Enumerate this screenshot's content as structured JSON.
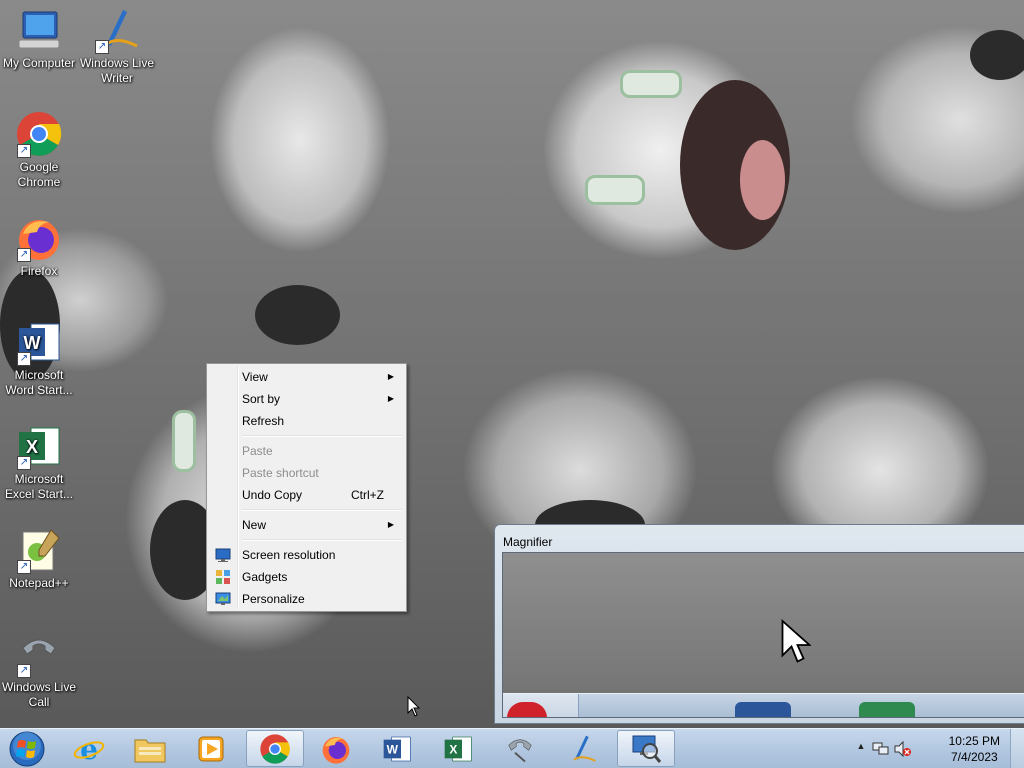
{
  "desktop": {
    "icons": [
      {
        "label": "My Computer",
        "icon": "computer-icon"
      },
      {
        "label": "Windows Live Writer",
        "icon": "live-writer-icon"
      },
      {
        "label": "Google Chrome",
        "icon": "chrome-icon"
      },
      {
        "label": "Firefox",
        "icon": "firefox-icon"
      },
      {
        "label": "Microsoft Word Start...",
        "icon": "word-icon"
      },
      {
        "label": "Microsoft Excel Start...",
        "icon": "excel-icon"
      },
      {
        "label": "Notepad++",
        "icon": "notepadpp-icon"
      },
      {
        "label": "Windows Live Call",
        "icon": "phone-icon"
      }
    ]
  },
  "context_menu": {
    "view": "View",
    "sort_by": "Sort by",
    "refresh": "Refresh",
    "paste": "Paste",
    "paste_shortcut": "Paste shortcut",
    "undo_copy": "Undo Copy",
    "undo_copy_key": "Ctrl+Z",
    "new": "New",
    "screen_resolution": "Screen resolution",
    "gadgets": "Gadgets",
    "personalize": "Personalize",
    "submenu_arrow": "▶"
  },
  "magnifier": {
    "title": "Magnifier"
  },
  "taskbar": {
    "items": [
      {
        "icon": "internet-explorer-icon"
      },
      {
        "icon": "windows-explorer-icon"
      },
      {
        "icon": "media-player-icon"
      },
      {
        "icon": "chrome-icon"
      },
      {
        "icon": "firefox-icon"
      },
      {
        "icon": "word-icon"
      },
      {
        "icon": "excel-icon"
      },
      {
        "icon": "phone-icon"
      },
      {
        "icon": "live-writer-icon"
      },
      {
        "icon": "magnifier-icon"
      }
    ],
    "tray_chevron": "▲",
    "clock_time": "10:25 PM",
    "clock_date": "7/4/2023"
  },
  "colors": {
    "taskbar": "#b3c8e1",
    "menu_bg": "#f0f0f0",
    "disabled_text": "#8d8d8d"
  }
}
